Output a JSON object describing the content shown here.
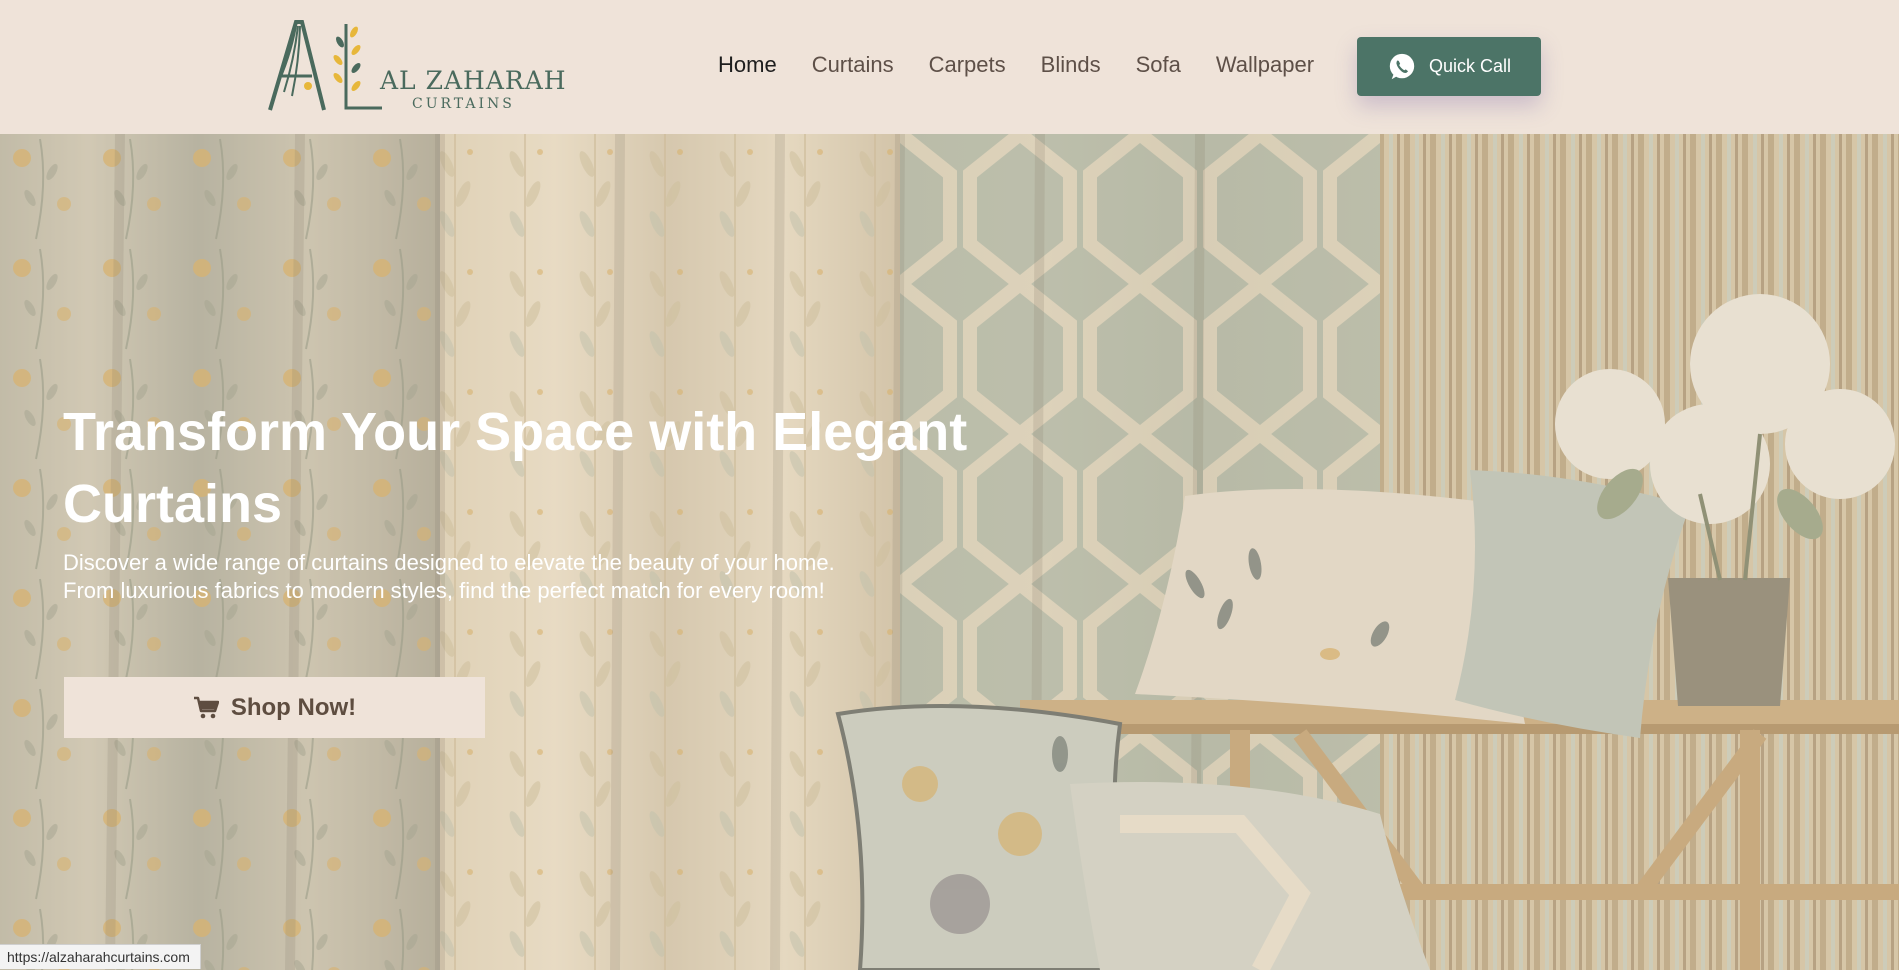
{
  "brand": {
    "name": "AL ZAHARAH",
    "subtitle": "CURTAINS",
    "primary_color": "#4c7467",
    "background_color": "#efe3d9"
  },
  "nav": {
    "items": [
      {
        "label": "Home",
        "active": true
      },
      {
        "label": "Curtains",
        "active": false
      },
      {
        "label": "Carpets",
        "active": false
      },
      {
        "label": "Blinds",
        "active": false
      },
      {
        "label": "Sofa",
        "active": false
      },
      {
        "label": "Wallpaper",
        "active": false
      }
    ]
  },
  "quick_call": {
    "label": "Quick Call",
    "icon": "whatsapp-icon"
  },
  "hero": {
    "title": "Transform Your Space with Elegant Curtains",
    "description_line1": "Discover a wide range of curtains designed to elevate the beauty of your home.",
    "description_line2": "From luxurious fabrics to modern styles, find the perfect match for every room!",
    "cta_label": "Shop Now!",
    "cta_icon": "cart-icon"
  },
  "status_bar": {
    "url": "https://alzaharahcurtains.com"
  }
}
